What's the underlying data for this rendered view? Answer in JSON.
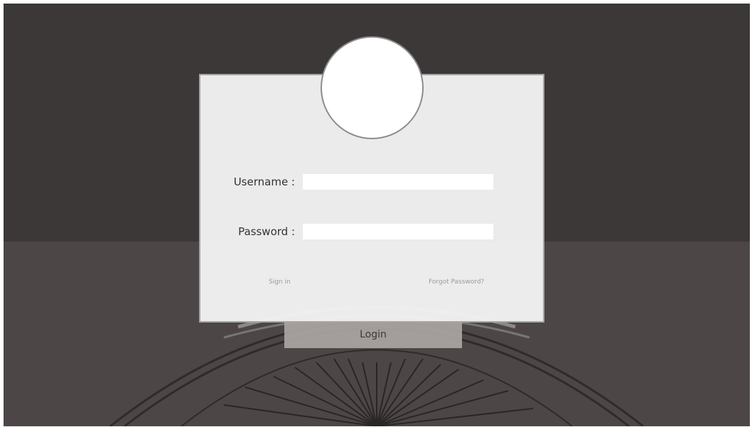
{
  "login_form": {
    "username_label": "Username :",
    "username_value": "",
    "password_label": "Password :",
    "password_value": "",
    "sign_in_link": "Sign in",
    "forgot_password_link": "Forgot Password?",
    "login_button": "Login"
  },
  "colors": {
    "background_top": "#3c3837",
    "background_bottom": "#4c4746",
    "card": "#f2f2f2",
    "card_border": "#a6a6a6",
    "avatar": "#ffffff",
    "login_button": "#aaa4a2",
    "link_text": "#9a9a9a"
  },
  "icons": {
    "avatar": "avatar-placeholder-circle",
    "background_decoration": "sunburst-arcs"
  }
}
